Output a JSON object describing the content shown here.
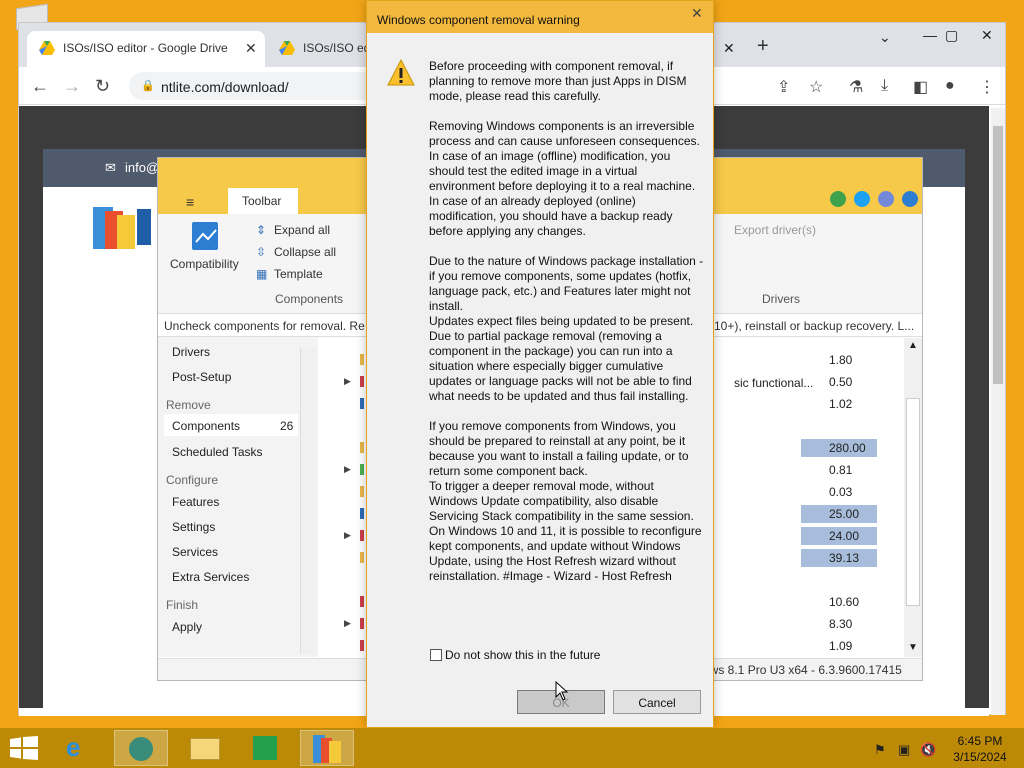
{
  "chrome": {
    "tabs": [
      {
        "title": "ISOs/ISO editor - Google Drive"
      },
      {
        "title": "ISOs/ISO ed"
      }
    ],
    "url": "ntlite.com/download/"
  },
  "website": {
    "email_snippet": "info@"
  },
  "ntlite": {
    "menu_toolbar_tab": "Toolbar",
    "ribbon": {
      "compatibility": "Compatibility",
      "expand_all": "Expand all",
      "collapse_all": "Collapse all",
      "template": "Template",
      "group_components": "Components",
      "export_drivers": "Export driver(s)",
      "group_drivers": "Drivers"
    },
    "infobar": "Uncheck components for removal. Re",
    "infobar_right": "10+), reinstall or backup recovery. L...",
    "sidebar": {
      "items_top": [
        "Drivers",
        "Post-Setup"
      ],
      "section_remove": "Remove",
      "components": "Components",
      "components_count": "26",
      "scheduled_tasks": "Scheduled Tasks",
      "section_configure": "Configure",
      "configure_items": [
        "Features",
        "Settings",
        "Services",
        "Extra Services"
      ],
      "section_finish": "Finish",
      "apply": "Apply"
    },
    "tree_snippet": "sic functional...",
    "tree_values": [
      {
        "v": "1.80",
        "bar": false
      },
      {
        "v": "0.50",
        "bar": false
      },
      {
        "v": "1.02",
        "bar": false
      },
      {
        "v": "280.00",
        "bar": true
      },
      {
        "v": "0.81",
        "bar": false
      },
      {
        "v": "0.03",
        "bar": false
      },
      {
        "v": "25.00",
        "bar": true
      },
      {
        "v": "24.00",
        "bar": true
      },
      {
        "v": "39.13",
        "bar": true
      },
      {
        "v": "10.60",
        "bar": false
      },
      {
        "v": "8.30",
        "bar": false
      },
      {
        "v": "1.09",
        "bar": false
      }
    ],
    "status": "ows 8.1 Pro U3 x64 - 6.3.9600.17415"
  },
  "dialog": {
    "title": "Windows component removal warning",
    "body": "Before proceeding with component removal, if planning to remove more than just Apps in DISM mode, please read this carefully.\n\nRemoving Windows components is an irreversible process and can cause unforeseen consequences.\nIn case of an image (offline) modification, you should test the edited image in a virtual environment before deploying it to a real machine.\nIn case of an already deployed (online) modification, you should have a backup ready before applying any changes.\n\nDue to the nature of Windows package installation - if you remove components, some updates (hotfix, language pack, etc.) and Features later might not install.\nUpdates expect files being updated to be present.\nDue to partial package removal (removing a component in the package) you can run into a situation where especially bigger cumulative updates or language packs will not be able to find what needs to be updated and thus fail installing.\n\nIf you remove components from Windows, you should be prepared to reinstall at any point, be it because you want to install a failing update, or to return some component back.\nTo trigger a deeper removal mode, without Windows Update compatibility, also disable Servicing Stack compatibility in the same session.\nOn Windows 10 and 11, it is possible to reconfigure kept components, and update without Windows Update, using the Host Refresh wizard without reinstallation. #Image - Wizard - Host Refresh",
    "checkbox_label": "Do not show this in the future",
    "ok": "OK",
    "cancel": "Cancel"
  },
  "taskbar": {
    "time": "6:45 PM",
    "date": "3/15/2024"
  }
}
